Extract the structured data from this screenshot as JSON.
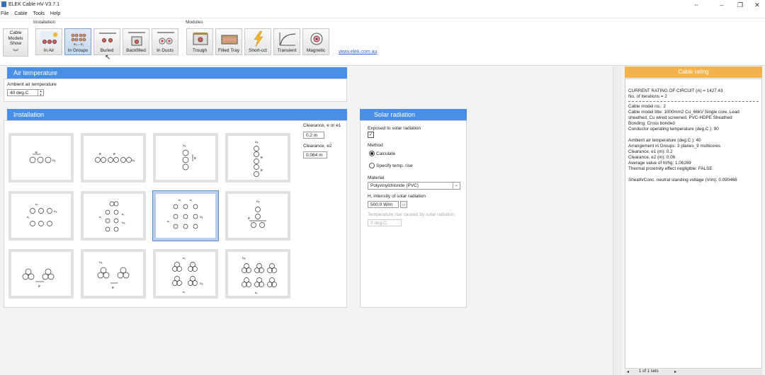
{
  "window": {
    "title": "ELEK Cable HV V3.7.1",
    "controls": [
      "–",
      "❐",
      "✕"
    ]
  },
  "menu": [
    "File",
    "Cable",
    "Tools",
    "Help"
  ],
  "ribbon": {
    "cable_models_show": [
      "Cable",
      "Models",
      "Show"
    ],
    "installation_label": "Installation",
    "modules_label": "Modules",
    "installation_buttons": [
      "In Air",
      "In Groups",
      "Buried",
      "Backfilled",
      "In Ducts"
    ],
    "selected_installation": "In Groups",
    "module_buttons": [
      "Trough",
      "Filled Tray",
      "Short-cct",
      "Transient",
      "Magnetic"
    ],
    "link": "www.elek.com.au"
  },
  "air_temperature": {
    "title": "Air temperature",
    "label": "Ambient air temperature",
    "value": "40 deg.C."
  },
  "installation": {
    "title": "Installation",
    "clearance_e1_label": "Clearance, e or e1",
    "clearance_e1_value": "0.2 m",
    "clearance_e2_label": "Clearance, e2",
    "clearance_e2_value": "0.064 m"
  },
  "solar": {
    "title": "Solar radiation",
    "exposed_label": "Exposed to solar radiation",
    "exposed_checked": true,
    "method_label": "Method",
    "method_calculate": "Calculate",
    "method_specify": "Specify temp. rise",
    "method_selected": "Calculate",
    "material_label": "Material",
    "material_value": "Polyvinylchloride (PVC)",
    "intensity_label": "H, intensity of solar radiation",
    "intensity_value": "500.0 W/m",
    "intensity_button": "...",
    "temp_rise_label": "Temperature rise caused by solar radiation",
    "temp_rise_value": "0 deg.C."
  },
  "cable_rating": {
    "title": "Cable rating",
    "lines_1": [
      "CURRENT RATING OF CIRCUIT (A) = 1427.43",
      "No. of iterations = 2"
    ],
    "lines_2": [
      "Cable model no.: 2",
      "Cable model title: 1000mm2 Cu_66kV Single core, Lead sheathed, Cu wired screened, PVC-HDPE Sheathed",
      "Bonding: Cross bonded",
      "Conductor operating temperature (deg.C.): 90"
    ],
    "lines_3": [
      "Ambient air temperature (deg.C.): 40",
      "Arrangement in Groups: 3 planes_9 multicores",
      "Clearance, e1 (m): 0.2",
      "Clearance, e2 (m): 0.06",
      "Average value of hl/hg: 1.06169",
      "Thermal proximity effect negligible: FALSE"
    ],
    "lines_4": [
      "Sheath/Conc. neutral standing voltage (V/m): 0.090468"
    ],
    "pager": "1 of 1 sets"
  },
  "colors": {
    "panel_header_blue": "#4a8fe6",
    "rating_header_orange": "#f4b24a",
    "selected_button": "#c4d7ec"
  }
}
